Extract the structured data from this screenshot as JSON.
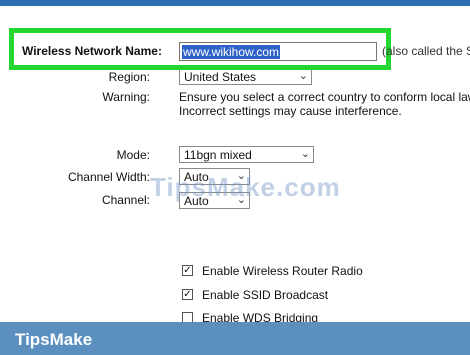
{
  "form": {
    "network_name": {
      "label": "Wireless Network Name:",
      "value": "www.wikihow.com",
      "hint": "(also called the S"
    },
    "region": {
      "label": "Region:",
      "value": "United States"
    },
    "warning": {
      "label": "Warning:",
      "line1": "Ensure you select a correct country to conform local law.",
      "line2": "Incorrect settings may cause interference."
    },
    "mode": {
      "label": "Mode:",
      "value": "11bgn mixed"
    },
    "channel_width": {
      "label": "Channel Width:",
      "value": "Auto"
    },
    "channel": {
      "label": "Channel:",
      "value": "Auto"
    },
    "checkboxes": [
      {
        "label": "Enable Wireless Router Radio",
        "checked": true
      },
      {
        "label": "Enable SSID Broadcast",
        "checked": true
      },
      {
        "label": "Enable WDS Bridging",
        "checked": false
      }
    ]
  },
  "watermark": {
    "text": "TipsMake.com"
  },
  "footer": {
    "brand": "TipsMake"
  },
  "colors": {
    "highlight": "#22d82f",
    "selection": "#2f62c8",
    "footer": "#5a8fc0"
  },
  "icons": {
    "dropdown": "chevron-down-icon",
    "check": "checkmark-icon"
  }
}
